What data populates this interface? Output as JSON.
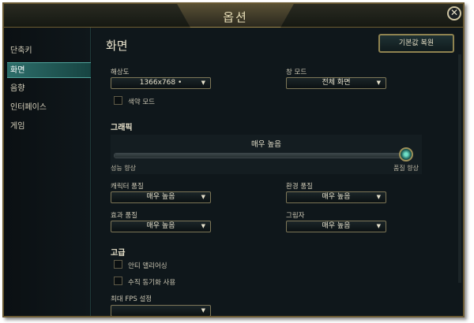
{
  "window": {
    "title": "옵션",
    "close_glyph": "✕"
  },
  "sidebar": {
    "items": [
      {
        "label": "단축키",
        "active": false
      },
      {
        "label": "화면",
        "active": true
      },
      {
        "label": "음향",
        "active": false
      },
      {
        "label": "인터페이스",
        "active": false
      },
      {
        "label": "게임",
        "active": false
      }
    ]
  },
  "screen": {
    "title": "화면",
    "reset_label": "기본값 복원",
    "resolution": {
      "label": "해상도",
      "value": "1366x768 •"
    },
    "window_mode": {
      "label": "창 모드",
      "value": "전체 화면"
    },
    "colorblind": {
      "label": "색약 모드",
      "checked": false
    }
  },
  "graphics": {
    "heading": "그래픽",
    "slider": {
      "value_label": "매우 높음",
      "left_label": "성능 향상",
      "right_label": "품질 향상",
      "level": 1.0
    },
    "character_quality": {
      "label": "캐릭터 품질",
      "value": "매우 높음"
    },
    "environment_quality": {
      "label": "환경 품질",
      "value": "매우 높음"
    },
    "effects_quality": {
      "label": "효과 품질",
      "value": "매우 높음"
    },
    "shadows": {
      "label": "그림자",
      "value": "매우 높음"
    }
  },
  "advanced": {
    "heading": "고급",
    "antialiasing": {
      "label": "안티 앨리어싱",
      "checked": false
    },
    "vsync": {
      "label": "수직 동기화 사용",
      "checked": false
    },
    "max_fps": {
      "label": "최대 FPS 설정",
      "value": ""
    }
  },
  "icons": {
    "dropdown_arrow": "▼"
  },
  "colors": {
    "accent": "#2d6e6a",
    "border_gold": "#8f8350",
    "background": "#0f171b"
  }
}
